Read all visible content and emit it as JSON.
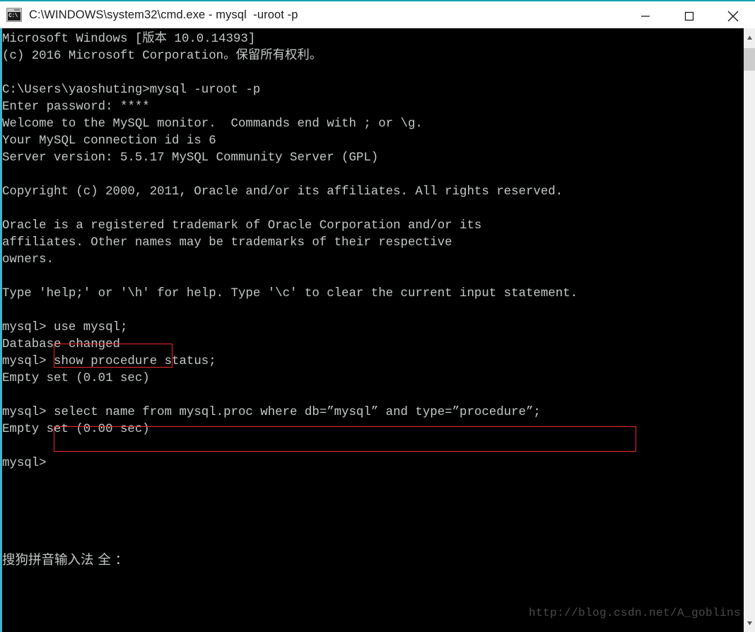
{
  "window": {
    "title": "C:\\WINDOWS\\system32\\cmd.exe - mysql  -uroot -p",
    "icon": "cmd-exe-icon",
    "icon_prompt_text": "C:\\",
    "accent_color": "#16a3b0",
    "titlebar_bg": "#ffffff",
    "console_bg": "#000000",
    "console_fg": "#c4c8c8",
    "annotation_color": "#ee2b2b",
    "controls": [
      {
        "name": "minimize",
        "label": "—"
      },
      {
        "name": "maximize",
        "label": "□"
      },
      {
        "name": "close",
        "label": "✕"
      }
    ]
  },
  "console": {
    "text": "Microsoft Windows [版本 10.0.14393]\n(c) 2016 Microsoft Corporation。保留所有权利。\n\nC:\\Users\\yaoshuting>mysql -uroot -p\nEnter password: ****\nWelcome to the MySQL monitor.  Commands end with ; or \\g.\nYour MySQL connection id is 6\nServer version: 5.5.17 MySQL Community Server (GPL)\n\nCopyright (c) 2000, 2011, Oracle and/or its affiliates. All rights reserved.\n\nOracle is a registered trademark of Oracle Corporation and/or its\naffiliates. Other names may be trademarks of their respective\nowners.\n\nType 'help;' or '\\h' for help. Type '\\c' to clear the current input statement.\n\nmysql> use mysql;\nDatabase changed\nmysql> show procedure status;\nEmpty set (0.01 sec)\n\nmysql> select name from mysql.proc where db=”mysql” and type=”procedure”;\nEmpty set (0.00 sec)\n\nmysql>",
    "lines": [
      "Microsoft Windows [版本 10.0.14393]",
      "(c) 2016 Microsoft Corporation。保留所有权利。",
      "",
      "C:\\Users\\yaoshuting>mysql -uroot -p",
      "Enter password: ****",
      "Welcome to the MySQL monitor.  Commands end with ; or \\g.",
      "Your MySQL connection id is 6",
      "Server version: 5.5.17 MySQL Community Server (GPL)",
      "",
      "Copyright (c) 2000, 2011, Oracle and/or its affiliates. All rights reserved.",
      "",
      "Oracle is a registered trademark of Oracle Corporation and/or its",
      "affiliates. Other names may be trademarks of their respective",
      "owners.",
      "",
      "Type 'help;' or '\\h' for help. Type '\\c' to clear the current input statement.",
      "",
      "mysql> use mysql;",
      "Database changed",
      "mysql> show procedure status;",
      "Empty set (0.01 sec)",
      "",
      "mysql> select name from mysql.proc where db=”mysql” and type=”procedure”;",
      "Empty set (0.00 sec)",
      "",
      "mysql>"
    ],
    "prompt": "mysql>",
    "server_version": "5.5.17",
    "connection_id": "6",
    "windows_version": "10.0.14393"
  },
  "annotations": {
    "box1_target": "use mysql;",
    "box2_target": "select name from mysql.proc where db=”mysql” and type=”procedure”;"
  },
  "ime": {
    "text": "搜狗拼音输入法 全 ："
  },
  "watermark": {
    "text": "http://blog.csdn.net/A_goblins"
  },
  "scrollbar": {
    "up_arrow": "scroll-up-arrow",
    "down_arrow": "scroll-down-arrow",
    "thumb": "scroll-thumb"
  }
}
